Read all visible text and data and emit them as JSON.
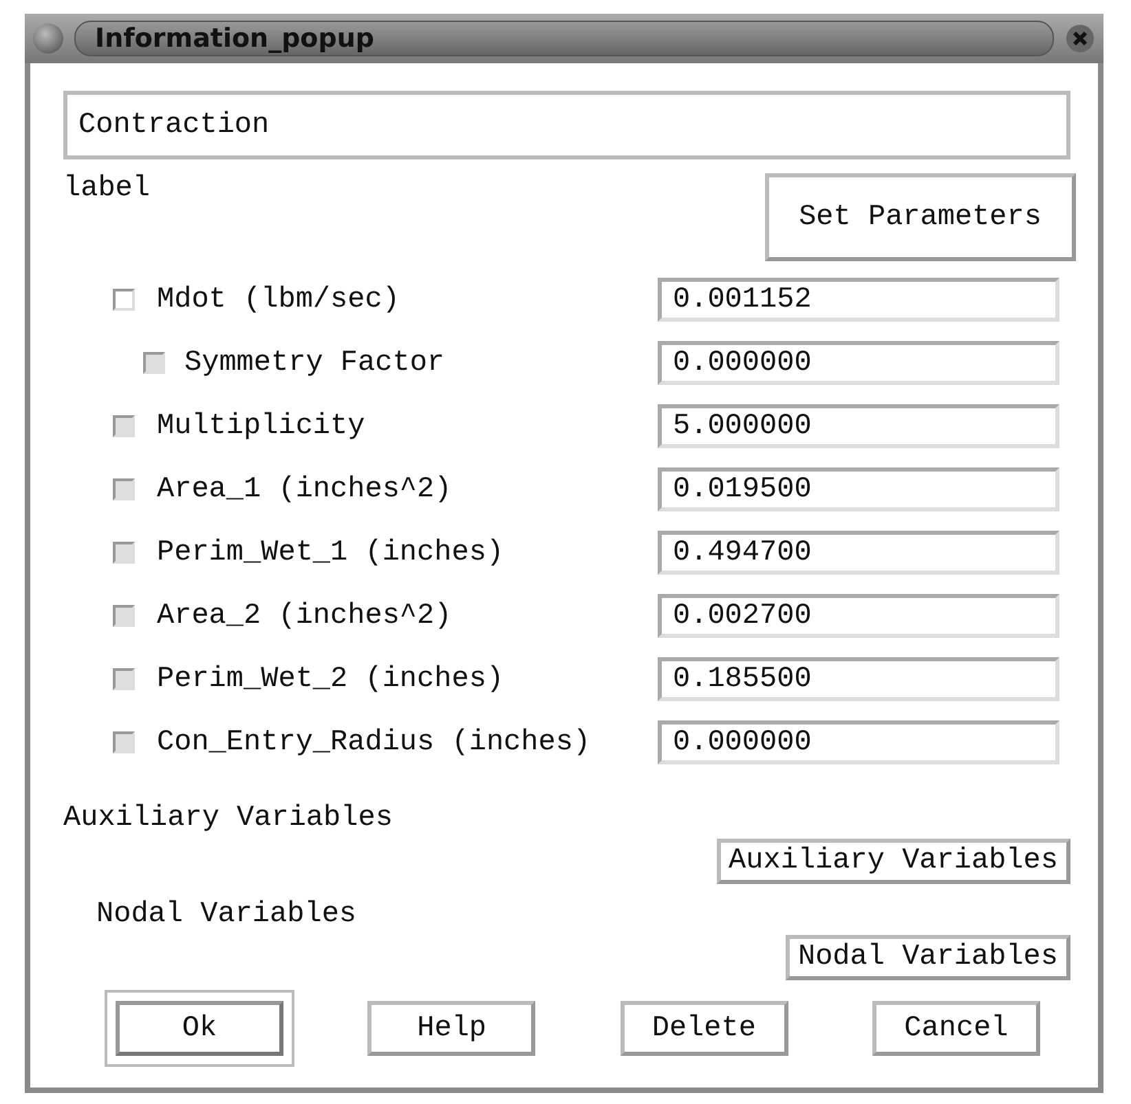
{
  "window": {
    "title": "Information_popup"
  },
  "name_field": {
    "value": "Contraction"
  },
  "label": "label",
  "set_parameters_button": "Set Parameters",
  "parameters": [
    {
      "label": "Mdot (lbm/sec)",
      "checked": false,
      "disabled": false,
      "value": "0.001152",
      "children": [
        {
          "label": "Symmetry Factor",
          "checked": false,
          "disabled": true,
          "value": "0.000000"
        }
      ]
    },
    {
      "label": "Multiplicity",
      "checked": false,
      "disabled": true,
      "value": "5.000000"
    },
    {
      "label": "Area_1 (inches^2)",
      "checked": false,
      "disabled": true,
      "value": "0.019500"
    },
    {
      "label": "Perim_Wet_1 (inches)",
      "checked": false,
      "disabled": true,
      "value": "0.494700"
    },
    {
      "label": "Area_2 (inches^2)",
      "checked": false,
      "disabled": true,
      "value": "0.002700"
    },
    {
      "label": "Perim_Wet_2 (inches)",
      "checked": false,
      "disabled": true,
      "value": "0.185500"
    },
    {
      "label": "Con_Entry_Radius (inches)",
      "checked": false,
      "disabled": true,
      "value": "0.000000"
    }
  ],
  "variable_sections": [
    {
      "label": "Auxiliary Variables",
      "button": "Auxiliary Variables"
    },
    {
      "label": "Nodal Variables",
      "button": "Nodal Variables"
    }
  ],
  "buttons": [
    {
      "label": "Ok",
      "default": true
    },
    {
      "label": "Help",
      "default": false
    },
    {
      "label": "Delete",
      "default": false
    },
    {
      "label": "Cancel",
      "default": false
    }
  ]
}
